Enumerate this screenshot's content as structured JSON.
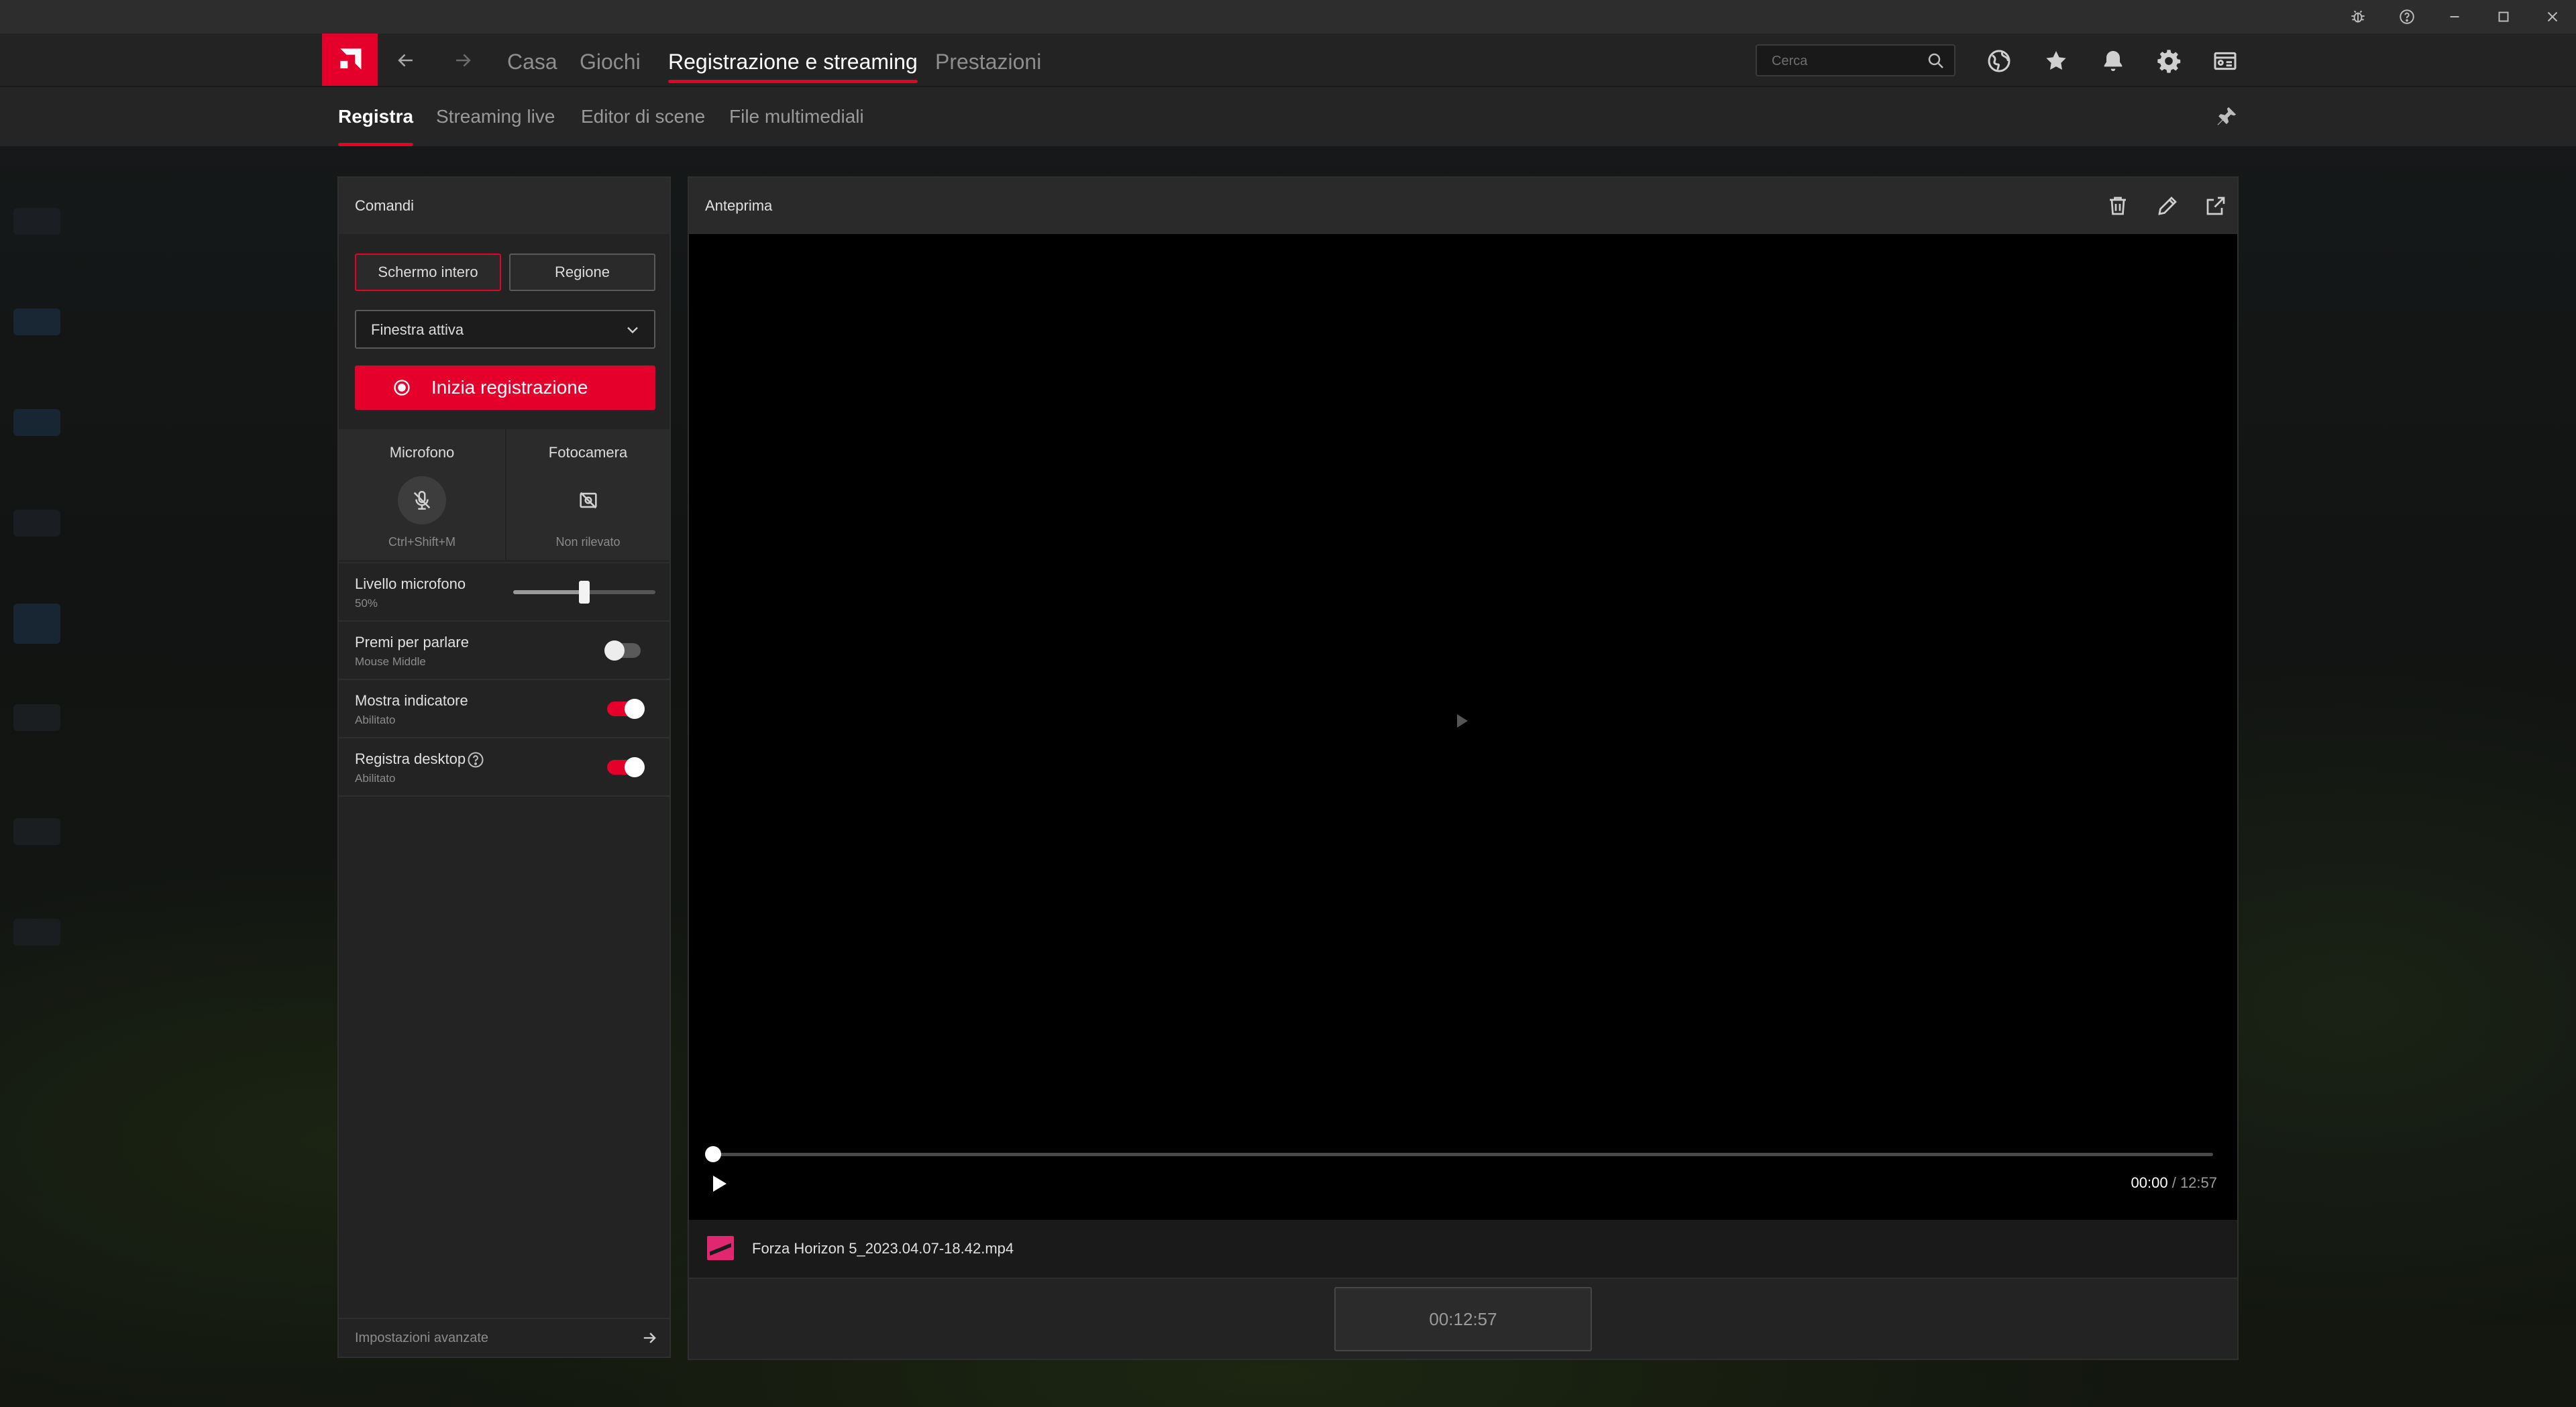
{
  "nav": {
    "items": [
      {
        "label": "Casa"
      },
      {
        "label": "Giochi"
      },
      {
        "label": "Registrazione e streaming"
      },
      {
        "label": "Prestazioni"
      }
    ],
    "search_placeholder": "Cerca"
  },
  "subnav": {
    "items": [
      {
        "label": "Registra"
      },
      {
        "label": "Streaming live"
      },
      {
        "label": "Editor di scene"
      },
      {
        "label": "File multimediali"
      }
    ]
  },
  "controls": {
    "title": "Comandi",
    "capture_full": "Schermo intero",
    "capture_region": "Regione",
    "dropdown_value": "Finestra attiva",
    "record_label": "Inizia registrazione",
    "mic": {
      "title": "Microfono",
      "sub": "Ctrl+Shift+M"
    },
    "camera": {
      "title": "Fotocamera",
      "sub": "Non rilevato"
    },
    "mic_level": {
      "title": "Livello microfono",
      "value": "50%",
      "fraction": 0.5
    },
    "push_to_talk": {
      "title": "Premi per parlare",
      "sub": "Mouse Middle",
      "on": false
    },
    "show_indicator": {
      "title": "Mostra indicatore",
      "sub": "Abilitato",
      "on": true
    },
    "record_desktop": {
      "title": "Registra desktop",
      "sub": "Abilitato",
      "on": true
    },
    "advanced": "Impostazioni avanzate"
  },
  "preview": {
    "title": "Anteprima",
    "current_time": "00:00",
    "total_time": "/ 12:57",
    "file_name": "Forza Horizon 5_2023.04.07-18.42.mp4",
    "duration": "00:12:57"
  },
  "colors": {
    "accent": "#e4002b",
    "panel": "#232323",
    "toolbar": "#2d2d2d"
  }
}
